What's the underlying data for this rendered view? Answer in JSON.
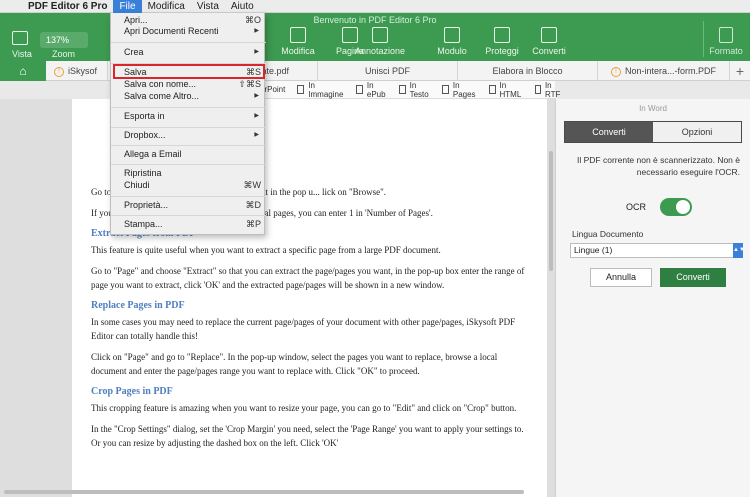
{
  "menubar": {
    "apple": "",
    "items": [
      "PDF Editor 6 Pro",
      "File",
      "Modifica",
      "Vista",
      "Aiuto"
    ],
    "active_index": 1
  },
  "window": {
    "title": "Benvenuto in PDF Editor 6 Pro"
  },
  "toolbar": {
    "vista": "Vista",
    "zoom_value": "137%",
    "zoom_label": "Zoom",
    "items": [
      {
        "label": "Modifica",
        "icon": "edit-icon"
      },
      {
        "label": "Pagina",
        "icon": "page-icon"
      },
      {
        "label": "Annotazione",
        "icon": "annotation-icon"
      },
      {
        "label": "Modulo",
        "icon": "form-icon"
      },
      {
        "label": "Proteggi",
        "icon": "lock-icon"
      },
      {
        "label": "Converti",
        "icon": "convert-icon"
      }
    ],
    "formato": "Formato"
  },
  "tabs": [
    {
      "label": "iSkysof"
    },
    {
      "label": "ate.pdf"
    },
    {
      "label": "Unisci PDF"
    },
    {
      "label": "Elabora in Blocco"
    },
    {
      "label": "Non-intera...-form.PDF"
    }
  ],
  "convert_strip": [
    "erPoint",
    "In Immagine",
    "In ePub",
    "In Testo",
    "In Pages",
    "In HTML",
    "In RTF"
  ],
  "file_menu": {
    "rows": [
      {
        "label": "Apri...",
        "shortcut": "⌘O"
      },
      {
        "label": "Apri Documenti Recenti",
        "submenu": true
      },
      {
        "label": "Crea",
        "submenu": true
      },
      {
        "label": "Salva",
        "shortcut": "⌘S"
      },
      {
        "label": "Salva con nome...",
        "shortcut": "⇧⌘S"
      },
      {
        "label": "Salva come Altro...",
        "submenu": true
      },
      {
        "label": "Esporta in",
        "submenu": true
      },
      {
        "label": "Dropbox...",
        "submenu": true
      },
      {
        "label": "Allega a Email"
      },
      {
        "label": "Ripristina"
      },
      {
        "label": "Chiudi",
        "shortcut": "⌘W"
      },
      {
        "label": "Proprietà...",
        "shortcut": "⌘D"
      },
      {
        "label": "Stampa...",
        "shortcut": "⌘P"
      }
    ]
  },
  "document": {
    "p1": "Go to ... se the number of pages you want to split in the pop u... lick on \"Browse\".",
    "p2": "If you want to split your document into individual pages, you can enter 1 in 'Number of Pages'.",
    "h1": "Extract Pages from PDF",
    "p3": "This feature is quite useful when you want to extract a specific page from a large PDF document.",
    "p4": "Go to \"Page\" and choose \"Extract\" so that you can extract the page/pages you want, in the pop-up box enter the range of page you want to extract, click 'OK' and the extracted page/pages will be shown in a new window.",
    "h2": "Replace Pages in PDF",
    "p5": "In some cases you may need to replace the current page/pages of your document with other page/pages, iSkysoft PDF Editor can totally handle this!",
    "p6": "Click on \"Page\" and go to \"Replace\". In the pop-up window, select the pages you want to replace, browse a local document and enter the page/pages range you want to replace with. Click \"OK\" to proceed.",
    "h3": "Crop Pages in PDF",
    "p7": "This cropping feature is amazing when you want to resize your page, you can go to \"Edit\" and click on \"Crop\" button.",
    "p8": "In the \"Crop Settings\" dialog, set the 'Crop Margin' you need, select the 'Page Range' you want to apply your settings to. Or you can resize by adjusting the dashed box on the left. Click 'OK'"
  },
  "panel": {
    "title": "In Word",
    "tab_convert": "Converti",
    "tab_options": "Opzioni",
    "message": "Il PDF corrente non è scannerizzato. Non è necessario eseguire l'OCR.",
    "ocr_label": "OCR",
    "ocr_on": true,
    "lang_label": "Lingua Documento",
    "lang_value": "Lingue (1)",
    "cancel": "Annulla",
    "convert": "Converti"
  },
  "colors": {
    "toolbar_green": "#3d9a51",
    "convert_button": "#2f7f42",
    "highlight_red": "#d8262c",
    "menu_active_blue": "#3a80d9",
    "heading_blue": "#4f7fc0"
  }
}
